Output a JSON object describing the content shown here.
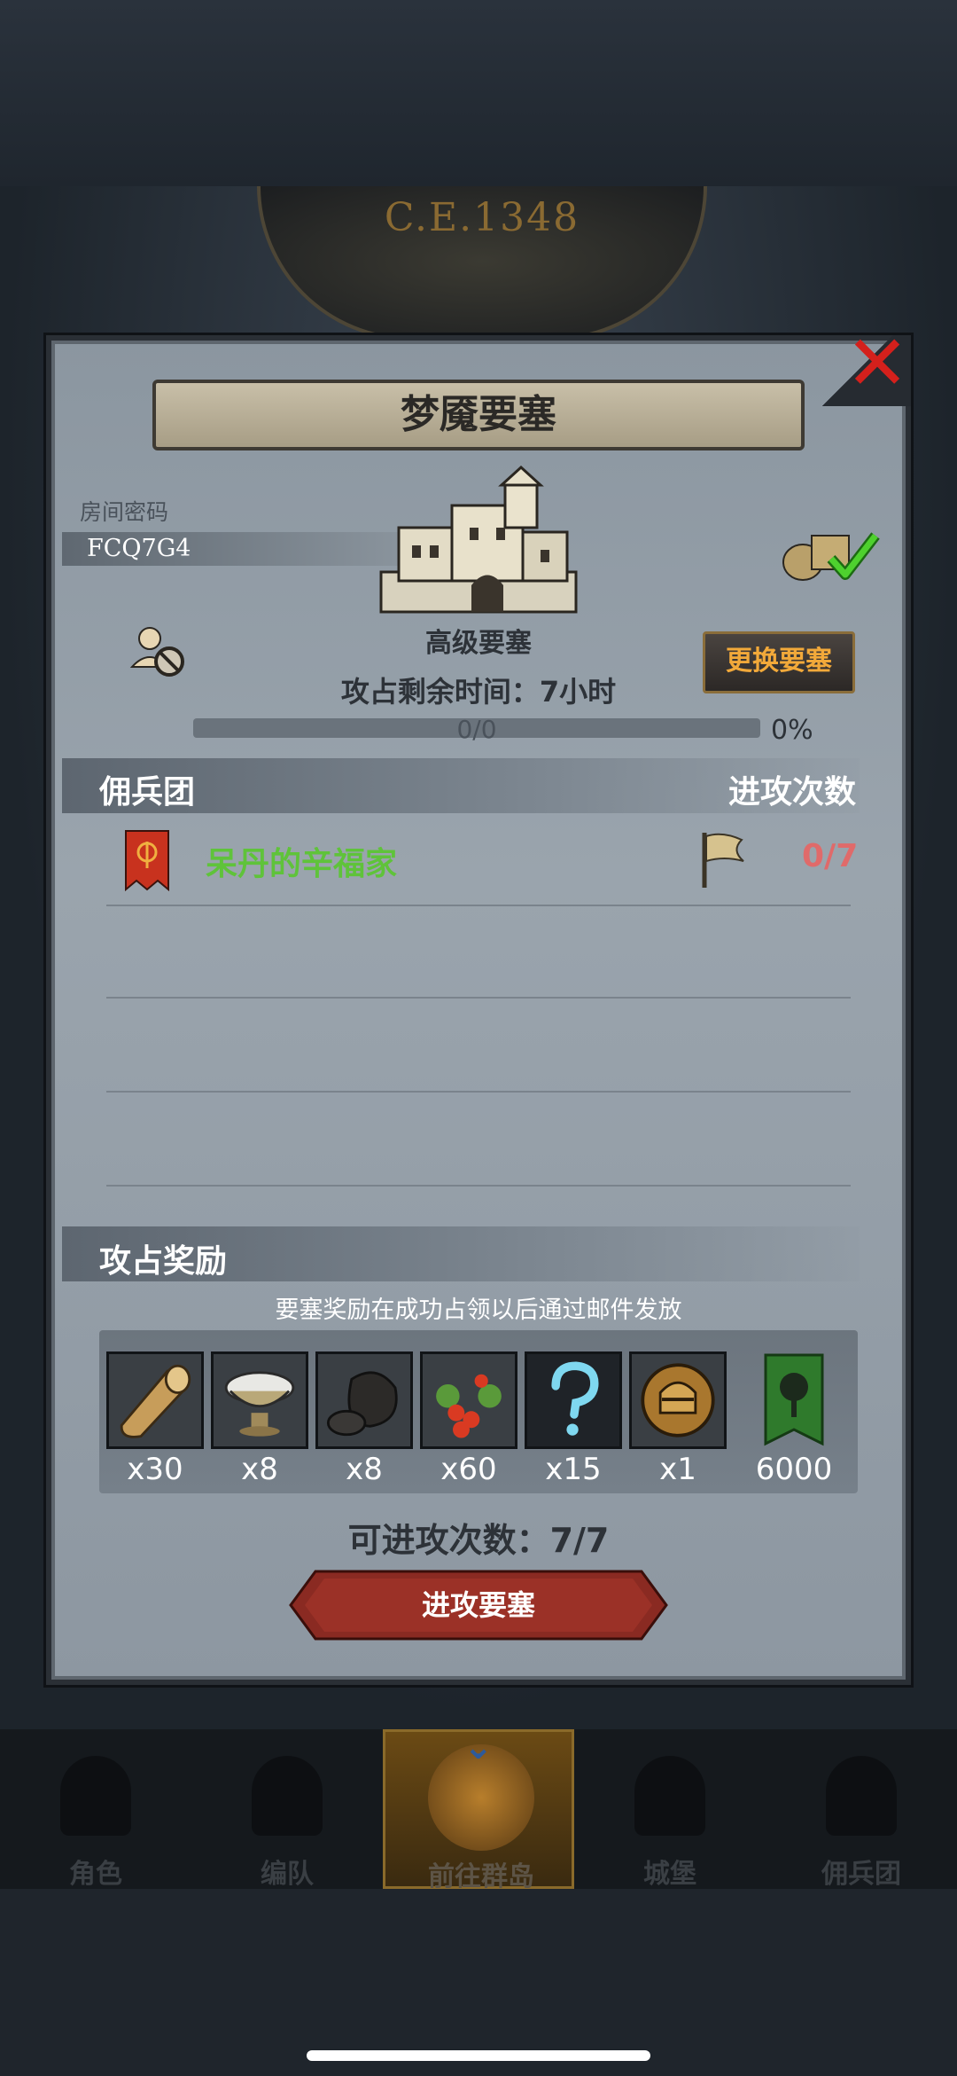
{
  "header": {
    "year": "C.E.1348"
  },
  "dialog": {
    "title": "梦魇要塞",
    "room_label": "房间密码",
    "room_code": "FCQ7G4",
    "fortress_tier": "高级要塞",
    "time_left": "攻占剩余时间：7小时",
    "change_button": "更换要塞",
    "progress_text": "0/0",
    "progress_percent": "0%",
    "progress_value": 0,
    "mercenary_section": "佣兵团",
    "attack_count_header": "进攻次数",
    "mercenaries": [
      {
        "name": "呆丹的辛福家",
        "attacks": "0/7"
      }
    ],
    "rewards_section": "攻占奖励",
    "reward_note": "要塞奖励在成功占领以后通过邮件发放",
    "rewards": [
      {
        "icon": "wood-log-icon",
        "qty": "x30"
      },
      {
        "icon": "silver-bowl-icon",
        "qty": "x8"
      },
      {
        "icon": "ore-icon",
        "qty": "x8"
      },
      {
        "icon": "berries-icon",
        "qty": "x60"
      },
      {
        "icon": "mystery-question-icon",
        "qty": "x15"
      },
      {
        "icon": "knight-helmet-icon",
        "qty": "x1"
      },
      {
        "icon": "guild-banner-icon",
        "qty": "6000"
      }
    ],
    "attacks_available": "可进攻次数：7/7",
    "attack_button": "进攻要塞"
  },
  "bottom_nav": [
    {
      "label": "角色"
    },
    {
      "label": "编队"
    },
    {
      "label": "前往群岛",
      "active": true
    },
    {
      "label": "城堡"
    },
    {
      "label": "佣兵团"
    }
  ],
  "colors": {
    "accent_gold": "#f2a93a",
    "merc_green": "#5fc33a",
    "count_red": "#e06a6a",
    "close_red": "#d4201c"
  }
}
